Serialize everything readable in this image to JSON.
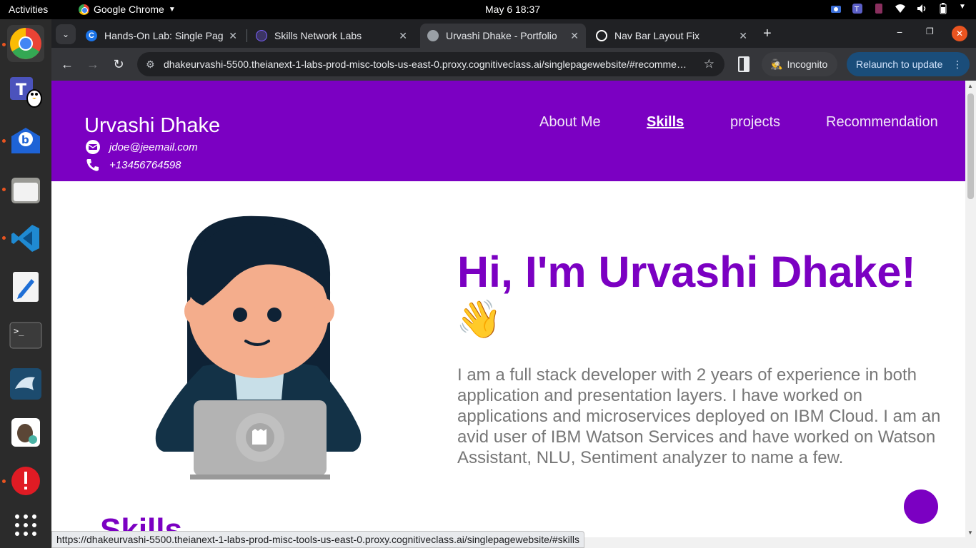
{
  "topbar": {
    "activities": "Activities",
    "app_name": "Google Chrome",
    "clock": "May 6  18:37"
  },
  "dock": {
    "items": [
      "chrome-icon",
      "teams-for-linux-icon",
      "mail-icon",
      "files-icon",
      "vscode-icon",
      "text-editor-icon",
      "terminal-icon",
      "mysql-workbench-icon",
      "dbeaver-icon",
      "update-icon"
    ],
    "show_apps": "show-apps-icon"
  },
  "browser": {
    "tabs": [
      {
        "title": "Hands-On Lab: Single Page",
        "favicon_color": "#1a73e8"
      },
      {
        "title": "Skills Network Labs",
        "favicon_color": "#7b61ff"
      },
      {
        "title": "Urvashi Dhake - Portfolio",
        "favicon_color": "#9aa0a6"
      },
      {
        "title": "Nav Bar Layout Fix",
        "favicon_color": "#ffffff"
      }
    ],
    "active_tab": 2,
    "url": "dhakeurvashi-5500.theianext-1-labs-prod-misc-tools-us-east-0.proxy.cognitiveclass.ai/singlepagewebsite/#recomme…",
    "incognito_label": "Incognito",
    "relaunch_label": "Relaunch to update",
    "status_url": "https://dhakeurvashi-5500.theianext-1-labs-prod-misc-tools-us-east-0.proxy.cognitiveclass.ai/singlepagewebsite/#skills"
  },
  "page": {
    "header": {
      "name": "Urvashi Dhake",
      "email": "jdoe@jeemail.com",
      "phone": "+13456764598",
      "nav": [
        "About Me",
        "Skills",
        "projects",
        "Recommendation"
      ],
      "current_nav": "Skills"
    },
    "hero": {
      "title": "Hi, I'm Urvashi Dhake!",
      "wave": "👋",
      "description": "I am a full stack developer with 2 years of experience in both application and presentation layers. I have worked on applications and microservices deployed on IBM Cloud. I am an avid user of IBM Watson Services and have worked on Watson Assistant, NLU, Sentiment analyzer to name a few."
    },
    "next_section_heading": "Skills"
  },
  "colors": {
    "brand_purple": "#7b00c2",
    "text_gray": "#777777"
  }
}
